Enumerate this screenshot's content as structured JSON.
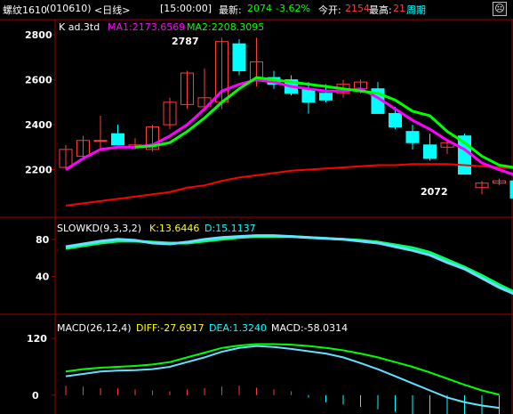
{
  "header": {
    "symbol": "螺纹1610",
    "code": "(010610)",
    "period": "<日线>",
    "time": "[15:00:00]",
    "latest_label": "最新:",
    "latest_value": "2074",
    "change_pct": "-3.62%",
    "open_label": "今开:",
    "open_value": "2154",
    "high_label": "最高:",
    "high_value": "21",
    "cycle_btn": "周期",
    "face_icon": "☹"
  },
  "colors": {
    "bg": "#000000",
    "up": "#ff3c3c",
    "down": "#00ffff",
    "ma1": "#ff00ff",
    "ma2": "#00ff00",
    "ma3": "#ff0000",
    "axis": "#a00000",
    "label": "#ffffff"
  },
  "panels": {
    "price": {
      "title": "K  ad.3td",
      "ma1": "MA1:2173.6569",
      "ma2": "MA2:2208.3095",
      "high_mark": "2787",
      "low_mark": "2072",
      "yticks": [
        "2800",
        "2600",
        "2400",
        "2200"
      ]
    },
    "kd": {
      "title": "SLOWKD(9,3,3,2)",
      "k": "K:13.6446",
      "d": "D:15.1137",
      "yticks": [
        "80",
        "40"
      ]
    },
    "macd": {
      "title": "MACD(26,12,4)",
      "diff": "DIFF:-27.6917",
      "dea": "DEA:1.3240",
      "macd": "MACD:-58.0314",
      "yticks": [
        "120",
        "0"
      ]
    }
  },
  "chart_data": [
    {
      "type": "candlestick",
      "ylim": [
        2000,
        2860
      ],
      "yticks": [
        2200,
        2400,
        2600,
        2800
      ],
      "candles": [
        {
          "o": 2210,
          "h": 2310,
          "l": 2200,
          "c": 2290
        },
        {
          "o": 2260,
          "h": 2350,
          "l": 2250,
          "c": 2330
        },
        {
          "o": 2330,
          "h": 2440,
          "l": 2290,
          "c": 2330
        },
        {
          "o": 2360,
          "h": 2400,
          "l": 2320,
          "c": 2310
        },
        {
          "o": 2300,
          "h": 2340,
          "l": 2290,
          "c": 2310
        },
        {
          "o": 2290,
          "h": 2400,
          "l": 2280,
          "c": 2390
        },
        {
          "o": 2400,
          "h": 2520,
          "l": 2380,
          "c": 2500
        },
        {
          "o": 2490,
          "h": 2640,
          "l": 2470,
          "c": 2630
        },
        {
          "o": 2480,
          "h": 2650,
          "l": 2460,
          "c": 2520
        },
        {
          "o": 2500,
          "h": 2787,
          "l": 2470,
          "c": 2770
        },
        {
          "o": 2760,
          "h": 2780,
          "l": 2620,
          "c": 2640
        },
        {
          "o": 2600,
          "h": 2787,
          "l": 2570,
          "c": 2680
        },
        {
          "o": 2610,
          "h": 2640,
          "l": 2560,
          "c": 2580
        },
        {
          "o": 2600,
          "h": 2620,
          "l": 2530,
          "c": 2540
        },
        {
          "o": 2560,
          "h": 2590,
          "l": 2450,
          "c": 2500
        },
        {
          "o": 2540,
          "h": 2580,
          "l": 2500,
          "c": 2510
        },
        {
          "o": 2540,
          "h": 2600,
          "l": 2520,
          "c": 2580
        },
        {
          "o": 2560,
          "h": 2600,
          "l": 2540,
          "c": 2590
        },
        {
          "o": 2560,
          "h": 2590,
          "l": 2450,
          "c": 2450
        },
        {
          "o": 2450,
          "h": 2480,
          "l": 2380,
          "c": 2390
        },
        {
          "o": 2370,
          "h": 2400,
          "l": 2290,
          "c": 2320
        },
        {
          "o": 2310,
          "h": 2360,
          "l": 2240,
          "c": 2250
        },
        {
          "o": 2300,
          "h": 2330,
          "l": 2270,
          "c": 2320
        },
        {
          "o": 2350,
          "h": 2360,
          "l": 2180,
          "c": 2180
        },
        {
          "o": 2120,
          "h": 2150,
          "l": 2090,
          "c": 2140
        },
        {
          "o": 2140,
          "h": 2160,
          "l": 2130,
          "c": 2150
        },
        {
          "o": 2150,
          "h": 2170,
          "l": 2072,
          "c": 2074
        }
      ],
      "ma1": [
        2200,
        2250,
        2290,
        2300,
        2300,
        2310,
        2350,
        2400,
        2470,
        2550,
        2580,
        2600,
        2590,
        2570,
        2560,
        2550,
        2550,
        2560,
        2520,
        2470,
        2420,
        2380,
        2330,
        2290,
        2230,
        2200,
        2174
      ],
      "ma2": [
        null,
        null,
        null,
        null,
        2300,
        2305,
        2320,
        2370,
        2430,
        2500,
        2560,
        2610,
        2600,
        2590,
        2580,
        2570,
        2560,
        2550,
        2540,
        2510,
        2460,
        2440,
        2370,
        2320,
        2260,
        2220,
        2208
      ],
      "ma3": [
        2040,
        2050,
        2060,
        2070,
        2080,
        2090,
        2100,
        2120,
        2130,
        2150,
        2165,
        2175,
        2185,
        2195,
        2200,
        2205,
        2210,
        2215,
        2220,
        2220,
        2225,
        2225,
        2225,
        2220,
        2215,
        2210,
        2205
      ]
    },
    {
      "type": "line",
      "ylim": [
        0,
        100
      ],
      "yticks": [
        40,
        80
      ],
      "series": [
        {
          "name": "K",
          "values": [
            72,
            75,
            78,
            80,
            79,
            76,
            75,
            77,
            80,
            82,
            83,
            84,
            84,
            83,
            82,
            81,
            80,
            78,
            76,
            72,
            68,
            63,
            55,
            48,
            38,
            28,
            20,
            14
          ]
        },
        {
          "name": "D",
          "values": [
            70,
            73,
            76,
            78,
            78,
            77,
            76,
            76,
            78,
            80,
            82,
            83,
            83,
            83,
            82,
            81,
            80,
            79,
            77,
            74,
            71,
            66,
            58,
            50,
            41,
            31,
            22,
            15
          ]
        }
      ]
    },
    {
      "type": "line",
      "ylim": [
        -40,
        160
      ],
      "yticks": [
        0,
        120
      ],
      "series": [
        {
          "name": "DIFF",
          "values": [
            40,
            45,
            50,
            52,
            53,
            55,
            60,
            70,
            80,
            92,
            100,
            104,
            102,
            98,
            93,
            88,
            80,
            68,
            55,
            40,
            25,
            10,
            -5,
            -15,
            -22,
            -27
          ]
        },
        {
          "name": "DEA",
          "values": [
            50,
            55,
            58,
            60,
            62,
            65,
            70,
            80,
            90,
            100,
            105,
            108,
            108,
            107,
            104,
            100,
            95,
            88,
            80,
            70,
            60,
            48,
            35,
            22,
            10,
            1
          ]
        }
      ],
      "bars": [
        20,
        18,
        15,
        14,
        12,
        10,
        8,
        12,
        15,
        18,
        20,
        16,
        12,
        8,
        -5,
        -15,
        -20,
        -25,
        -30,
        -35,
        -40,
        -45,
        -50,
        -52,
        -55,
        -58
      ]
    }
  ]
}
